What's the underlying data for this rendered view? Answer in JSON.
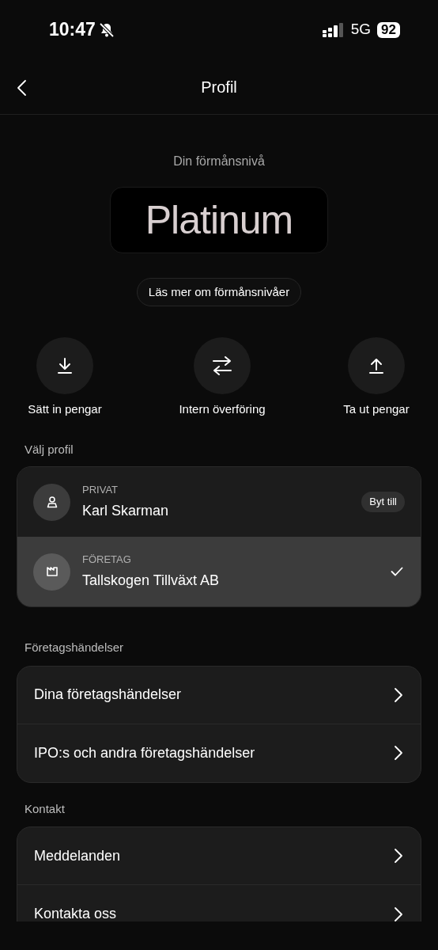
{
  "status_bar": {
    "time": "10:47",
    "muted": true,
    "network": "5G",
    "battery": "92"
  },
  "header": {
    "title": "Profil"
  },
  "tier": {
    "caption": "Din förmånsnivå",
    "name": "Platinum",
    "link": "Läs mer om förmånsnivåer"
  },
  "actions": [
    {
      "kind": "deposit",
      "label": "Sätt in pengar"
    },
    {
      "kind": "transfer",
      "label": "Intern överföring"
    },
    {
      "kind": "withdraw",
      "label": "Ta ut pengar"
    }
  ],
  "profile_section": {
    "title": "Välj profil",
    "profiles": [
      {
        "kind": "private",
        "type_label": "PRIVAT",
        "name": "Karl Skarman",
        "selected": false,
        "switch_label": "Byt till"
      },
      {
        "kind": "company",
        "type_label": "FÖRETAG",
        "name": "Tallskogen Tillväxt AB",
        "selected": true
      }
    ]
  },
  "sections": [
    {
      "title": "Företagshändelser",
      "items": [
        "Dina företagshändelser",
        "IPO:s och andra företagshändelser"
      ]
    },
    {
      "title": "Kontakt",
      "items": [
        "Meddelanden",
        "Kontakta oss"
      ]
    }
  ]
}
